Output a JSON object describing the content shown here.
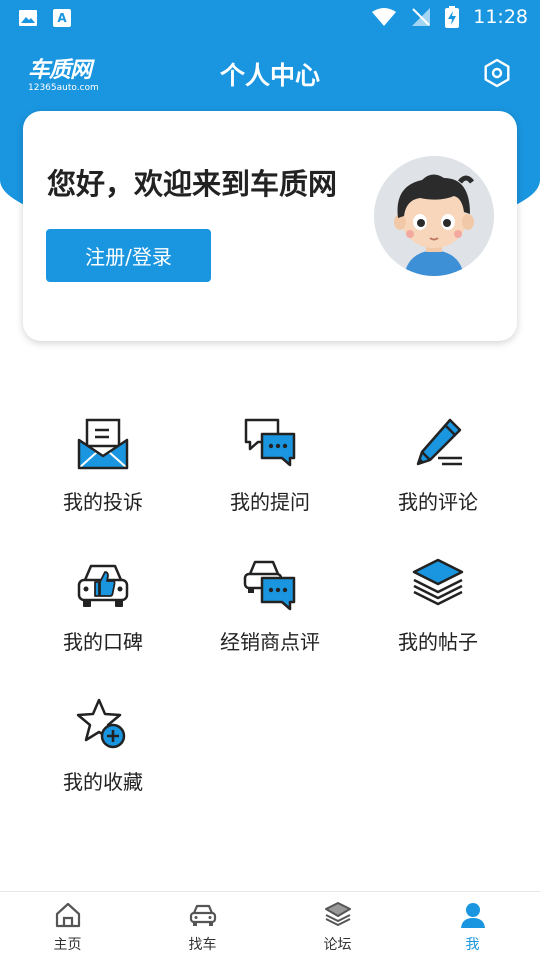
{
  "status_bar": {
    "time": "11:28"
  },
  "app_bar": {
    "logo_text": "车质网",
    "logo_sub": "12365auto.com",
    "title": "个人中心"
  },
  "profile": {
    "welcome": "您好，欢迎来到车质网",
    "login_label": "注册/登录"
  },
  "menu": [
    {
      "label": "我的投诉",
      "icon": "complaint-envelope-icon"
    },
    {
      "label": "我的提问",
      "icon": "chat-bubbles-icon"
    },
    {
      "label": "我的评论",
      "icon": "pencil-comment-icon"
    },
    {
      "label": "我的口碑",
      "icon": "car-thumbs-up-icon"
    },
    {
      "label": "经销商点评",
      "icon": "car-chat-icon"
    },
    {
      "label": "我的帖子",
      "icon": "layers-icon"
    },
    {
      "label": "我的收藏",
      "icon": "star-add-icon"
    }
  ],
  "bottom_nav": [
    {
      "label": "主页",
      "icon": "home-icon"
    },
    {
      "label": "找车",
      "icon": "car-icon"
    },
    {
      "label": "论坛",
      "icon": "layers-icon"
    },
    {
      "label": "我",
      "icon": "person-icon",
      "active": true
    }
  ],
  "colors": {
    "accent": "#1a96e0",
    "background": "#ffffff"
  }
}
